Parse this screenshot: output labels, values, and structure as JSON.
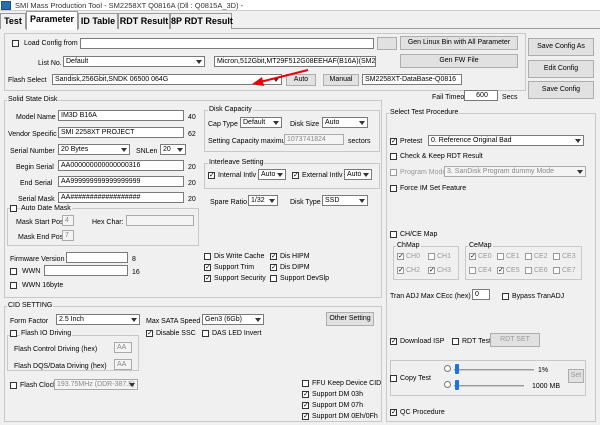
{
  "window": {
    "title": "SMI Mass Production Tool    -    SM2258XT    Q0816A    (Dll : Q0815A_3D)   -"
  },
  "tabs": [
    "Test",
    "Parameter",
    "ID Table",
    "RDT Result",
    "8P RDT Result"
  ],
  "top": {
    "load_config": "Load Config from",
    "list_no_label": "List No.",
    "list_no_value": "Default",
    "flash_info": "Micron,512Gbit,MT29F512G08EEHAF(B16A)(SM2258XT)",
    "flash_select_label": "Flash Select",
    "flash_select_value": "Sandisk,256Gbit,SNDK 06500 064G",
    "auto_btn": "Auto",
    "manual_btn": "Manual",
    "database": "SM2258XT-DataBase-Q0816",
    "gen_linux_btn": "Gen Linux Bin with All Parameter",
    "gen_fw_btn": "Gen FW File",
    "save_config_as_btn": "Save Config As",
    "edit_config_btn": "Edit Config",
    "save_config_btn": "Save Config",
    "fail_timeout_label": "Fail Timeout",
    "fail_timeout_value": "600",
    "fail_timeout_unit": "Secs"
  },
  "ssd": {
    "title": "Solid State Disk",
    "model_name_label": "Model Name",
    "model_name": "IM3D B16A",
    "model_name_len": "40",
    "vendor_label": "Vendor Specific",
    "vendor": "SMI 2258XT PROJECT",
    "vendor_len": "62",
    "serial_number_label": "Serial Number",
    "serial_bytes": "20 Bytes",
    "snlen_label": "SNLen",
    "snlen": "20",
    "begin_serial_label": "Begin Serial",
    "begin_serial": "AA000000000000000316",
    "begin_serial_len": "20",
    "end_serial_label": "End Serial",
    "end_serial": "AA999999999999999999",
    "end_serial_len": "20",
    "serial_mask_label": "Serial Mask",
    "serial_mask": "AA##################",
    "serial_mask_len": "20",
    "auto_date_mask": "Auto Date Mask",
    "mask_start_label": "Mask Start Pos",
    "mask_start": "4",
    "hex_char_label": "Hex Char:",
    "mask_end_label": "Mask End Pos",
    "mask_end": "7",
    "fw_version_label": "Firmware Version",
    "fw_version_len": "8",
    "wwn_label": "WWN",
    "wwn_len": "16",
    "wwn16_label": "WWN 16byte"
  },
  "capacity": {
    "title": "Disk Capacity",
    "cap_type_label": "Cap Type",
    "cap_type": "Default",
    "disk_size_label": "Disk Size",
    "disk_size": "Auto",
    "setting_cap_label": "Setting Capacity maximum",
    "setting_cap": "1073741824",
    "sectors_label": "sectors"
  },
  "interleave": {
    "title": "Interleave Setting",
    "internal_label": "Internal Intlv",
    "internal_value": "Auto",
    "external_label": "External Intlv",
    "external_value": "Auto",
    "spare_label": "Spare Ratio",
    "spare_value": "1/32",
    "disk_type_label": "Disk Type",
    "disk_type_value": "SSD"
  },
  "features": {
    "dis_write_cache": "Dis Write Cache",
    "support_trim": "Support Trim",
    "support_security": "Support Security",
    "dis_hipm": "Dis HIPM",
    "dis_dipm": "Dis DIPM",
    "support_devslp": "Support DevSlp"
  },
  "cid": {
    "title": "CID SETTING",
    "form_factor_label": "Form Factor",
    "form_factor": "2.5 Inch",
    "max_sata_label": "Max SATA Speed",
    "max_sata": "Gen3 (6Gb)",
    "other_setting_btn": "Other Setting",
    "flash_io": "Flash IO Driving",
    "disable_ssc": "Disable SSC",
    "das_led": "DAS LED Invert",
    "ctrl_driving_label": "Flash Control Driving (hex)",
    "ctrl_driving": "AA",
    "dqs_driving_label": "Flash DQS/Data Driving (hex)",
    "dqs_driving": "AA",
    "flash_clock_label": "Flash Clock",
    "flash_clock": "193.75MHz (DDR-387.5)",
    "ffu_label": "FFU Keep Device CID",
    "dm03_label": "Support DM 03h",
    "dm07_label": "Support DM 07h",
    "dm0e_label": "Support DM 0Eh/0Fh"
  },
  "test": {
    "title": "Select Test Procedure",
    "pretest_label": "Pretest",
    "pretest_value": "0. Reference Original Bad",
    "check_rdt": "Check & Keep RDT Result",
    "program_mode_label": "Program Mode",
    "program_mode_value": "3. SanDisk Program dummy Mode",
    "force_im": "Force IM Set Feature",
    "ch_ce_map_label": "CH/CE Map",
    "chmap_title": "ChMap",
    "cemap_title": "CeMap",
    "ch_labels": [
      "CH0",
      "CH1",
      "CH2",
      "CH3"
    ],
    "ce_labels": [
      "CE0",
      "CE1",
      "CE2",
      "CE3",
      "CE4",
      "CE5",
      "CE6",
      "CE7"
    ],
    "tran_adj_label": "Tran ADJ Max CEcc (hex)",
    "tran_adj_value": "0",
    "bypass_label": "Bypass TranADJ",
    "download_isp": "Download ISP",
    "rdt_test": "RDT Test",
    "rdt_set_btn": "RDT SET",
    "copy_test": "Copy Test",
    "copy_pct": "1%",
    "copy_size": "1000 MB",
    "set_btn": "Set",
    "qc_procedure": "QC Procedure"
  },
  "colors": {
    "accent": "#1a73e8",
    "arrow": "#e8000d"
  }
}
